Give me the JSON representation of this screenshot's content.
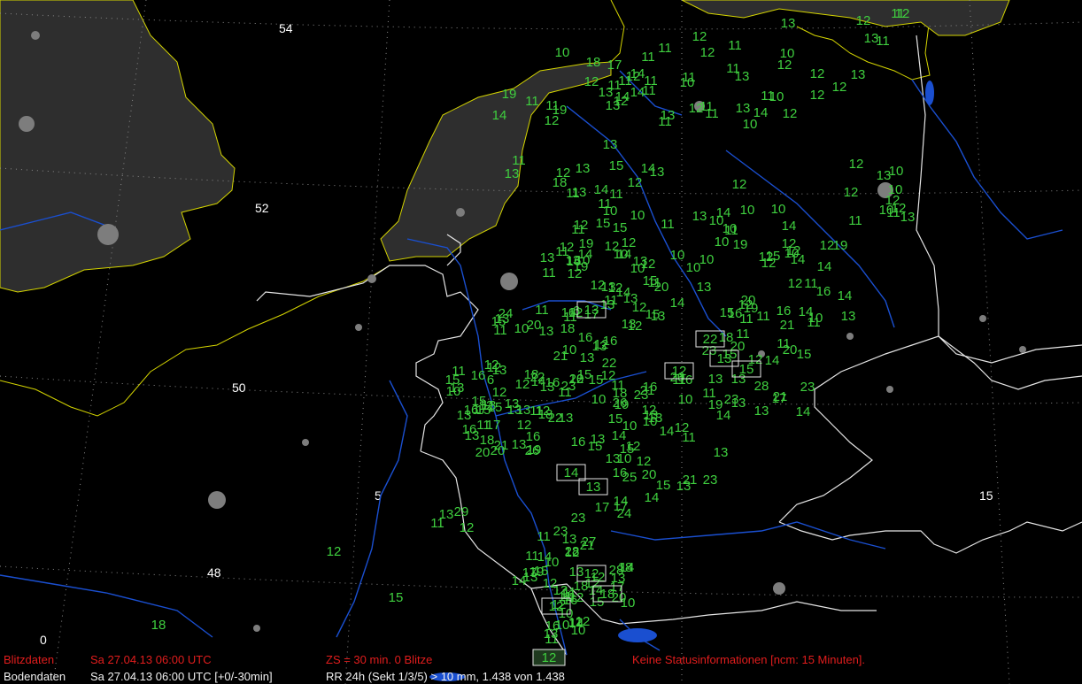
{
  "map": {
    "colors": {
      "background": "#000000",
      "land_uk_nl": "#2e2e2e",
      "coast": "#d4d400",
      "border": "#e6e6e6",
      "river": "#1a4fd0",
      "grid": "#8a8a8a",
      "value": "#3fcf3f",
      "city": "#7d7d7d",
      "status_red": "#e21d1d",
      "status_white": "#f0f0f0"
    },
    "grid_labels": [
      "54",
      "52",
      "50",
      "48",
      "5",
      "15",
      "0"
    ],
    "precip_values": [
      "13",
      "14",
      "13",
      "13",
      "15",
      "14",
      "12",
      "12",
      "11",
      "14",
      "14",
      "12",
      "11",
      "13",
      "19",
      "14",
      "19",
      "12",
      "13",
      "11",
      "12",
      "14",
      "13",
      "17",
      "18",
      "13",
      "11",
      "11",
      "18",
      "10",
      "12",
      "13",
      "12",
      "11",
      "12",
      "14",
      "10",
      "11",
      "13",
      "10",
      "10",
      "11",
      "12",
      "11",
      "12",
      "12",
      "11",
      "13",
      "10",
      "12",
      "11",
      "11",
      "11",
      "13",
      "11",
      "12",
      "11",
      "11",
      "12",
      "13",
      "10",
      "12",
      "12",
      "12",
      "10",
      "11",
      "10",
      "13",
      "10",
      "12",
      "10",
      "10",
      "11",
      "12",
      "10",
      "10",
      "11",
      "10",
      "12",
      "13",
      "11",
      "13",
      "19",
      "14",
      "15",
      "10",
      "13",
      "10",
      "11",
      "10",
      "12",
      "14",
      "15",
      "10",
      "10",
      "11",
      "12",
      "12",
      "15",
      "11",
      "10",
      "12",
      "12",
      "13",
      "14",
      "19",
      "10",
      "11",
      "11",
      "12",
      "15",
      "11",
      "11",
      "14",
      "14",
      "20",
      "12",
      "14",
      "14",
      "13",
      "12",
      "10",
      "16",
      "11",
      "16",
      "12",
      "19",
      "16",
      "13",
      "13",
      "12",
      "11",
      "12",
      "13",
      "11",
      "13",
      "12",
      "12",
      "11",
      "10",
      "11",
      "13",
      "14",
      "14",
      "15",
      "13",
      "15",
      "16",
      "12",
      "12",
      "14",
      "13",
      "12",
      "12",
      "19",
      "13",
      "20",
      "19",
      "12",
      "13",
      "12",
      "20",
      "22",
      "11",
      "16",
      "10",
      "13",
      "12",
      "13",
      "16",
      "11",
      "12",
      "11",
      "15",
      "20",
      "6",
      "6",
      "14",
      "18",
      "24",
      "21",
      "16",
      "10",
      "15",
      "11",
      "17",
      "13",
      "12",
      "13",
      "15",
      "16",
      "12",
      "16",
      "13",
      "10",
      "15",
      "13",
      "11",
      "18",
      "20",
      "12",
      "13",
      "16",
      "20",
      "16",
      "11",
      "15",
      "17",
      "13",
      "21",
      "13",
      "15",
      "13",
      "17",
      "13",
      "18",
      "11",
      "12",
      "10",
      "12",
      "16",
      "13",
      "22",
      "26",
      "16",
      "19",
      "22",
      "26",
      "23",
      "12",
      "18",
      "12",
      "15",
      "14",
      "13",
      "19",
      "11",
      "10",
      "12",
      "10",
      "15",
      "16",
      "15",
      "21",
      "13",
      "23",
      "13",
      "15",
      "20",
      "13",
      "16",
      "13",
      "18",
      "14",
      "13",
      "15",
      "16",
      "14",
      "20",
      "14",
      "10",
      "11",
      "11",
      "13",
      "19",
      "12",
      "23",
      "21",
      "25",
      "10",
      "11",
      "12",
      "13",
      "23",
      "13",
      "17",
      "21",
      "14",
      "20",
      "18",
      "15",
      "15",
      "11",
      "13",
      "14",
      "12",
      "20",
      "23",
      "11",
      "21",
      "28",
      "23",
      "13",
      "17",
      "15",
      "28",
      "10",
      "14",
      "24",
      "12",
      "28",
      "23",
      "18",
      "12",
      "11",
      "15",
      "27",
      "16",
      "13",
      "23",
      "14",
      "12",
      "19",
      "20",
      "12",
      "17",
      "10",
      "21",
      "11",
      "13",
      "14",
      "17",
      "14",
      "11",
      "12",
      "29",
      "13",
      "12",
      "15",
      "18",
      "14",
      "16",
      "11",
      "12",
      "13",
      "14",
      "11",
      "11",
      "13",
      "10",
      "18",
      "12",
      "17",
      "12",
      "16",
      "10",
      "12",
      "13",
      "10",
      "13",
      "12",
      "11",
      "12",
      "13",
      "11"
    ],
    "boxed_values": [
      "13",
      "22",
      "12",
      "13",
      "15",
      "14",
      "18",
      "12",
      "12",
      "13"
    ],
    "boxed_extra": [
      "12"
    ]
  },
  "status": {
    "row1": {
      "label": "Blitzdaten",
      "datetime": "Sa 27.04.13 06:00 UTC",
      "zs": "ZS = 30 min. 0 Blitze",
      "info": "Keine Statusinformationen [ncm: 15 Minuten]."
    },
    "row2": {
      "label": "Bodendaten",
      "datetime": "Sa 27.04.13 06:00 UTC [+0/-30min]",
      "rr": "RR 24h (Sekt 1/3/5) > 10 mm, 1.438 von 1.438"
    }
  }
}
